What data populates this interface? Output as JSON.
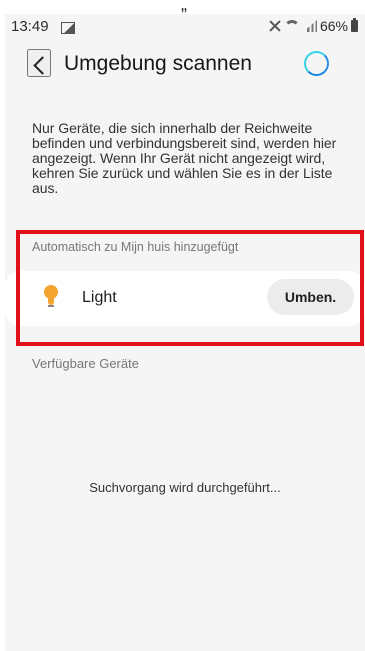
{
  "status_bar": {
    "time": "13:49",
    "battery": "66%",
    "icons": [
      "gallery-icon",
      "mute-icon",
      "wifi-icon",
      "signal-icon",
      "battery-icon"
    ]
  },
  "header": {
    "title": "Umgebung scannen",
    "back_icon": "chevron-left-icon",
    "loading_icon": "loading-spinner-icon"
  },
  "intro": {
    "text": "Nur Geräte, die sich innerhalb der Reichweite befinden und verbindungsbereit sind, werden hier angezeigt. Wenn Ihr Gerät nicht angezeigt wird, kehren Sie zurück und wählen Sie es in der Liste aus."
  },
  "sections": {
    "auto_added": "Automatisch zu Mijn huis hinzugefügt",
    "available": "Verfügbare Geräte"
  },
  "device": {
    "name": "Light",
    "icon": "lightbulb-icon",
    "rename_label": "Umben."
  },
  "scan": {
    "status": "Suchvorgang wird durchgeführt..."
  },
  "decorations": {
    "top_quote": "„"
  },
  "colors": {
    "accent": "#1387e5",
    "highlight": "#e30f1a",
    "bulb": "#f4a431"
  }
}
